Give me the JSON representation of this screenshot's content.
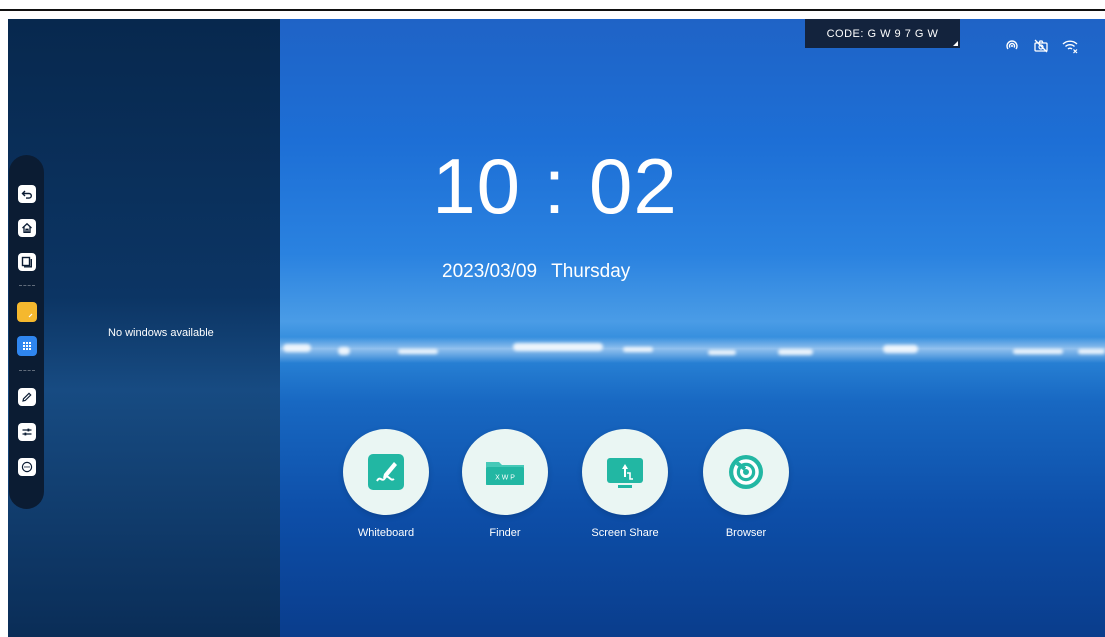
{
  "left_panel": {
    "empty_message": "No windows available"
  },
  "dock": {
    "items": [
      {
        "icon": "back-icon"
      },
      {
        "icon": "home-icon"
      },
      {
        "icon": "windows-icon"
      },
      {
        "icon": "sticky-note-icon",
        "color": "#f5b82e"
      },
      {
        "icon": "apps-grid-icon",
        "color": "#2f86f0"
      },
      {
        "icon": "pen-icon"
      },
      {
        "icon": "settings-sliders-icon"
      },
      {
        "icon": "more-icon"
      }
    ]
  },
  "header": {
    "code": "CODE: G W 9 7 G W",
    "status_icons": [
      "hotspot-icon",
      "camera-off-icon",
      "wifi-disconnected-icon"
    ]
  },
  "clock": {
    "time": "10 : 02",
    "date": "2023/03/09",
    "weekday": "Thursday"
  },
  "apps": [
    {
      "label": "Whiteboard",
      "icon": "whiteboard-icon"
    },
    {
      "label": "Finder",
      "icon": "finder-icon",
      "icon_text": "X W P"
    },
    {
      "label": "Screen Share",
      "icon": "screen-share-icon"
    },
    {
      "label": "Browser",
      "icon": "browser-icon"
    }
  ],
  "colors": {
    "app_accent": "#22b7a3",
    "dock_bg": "#0b1c33"
  }
}
